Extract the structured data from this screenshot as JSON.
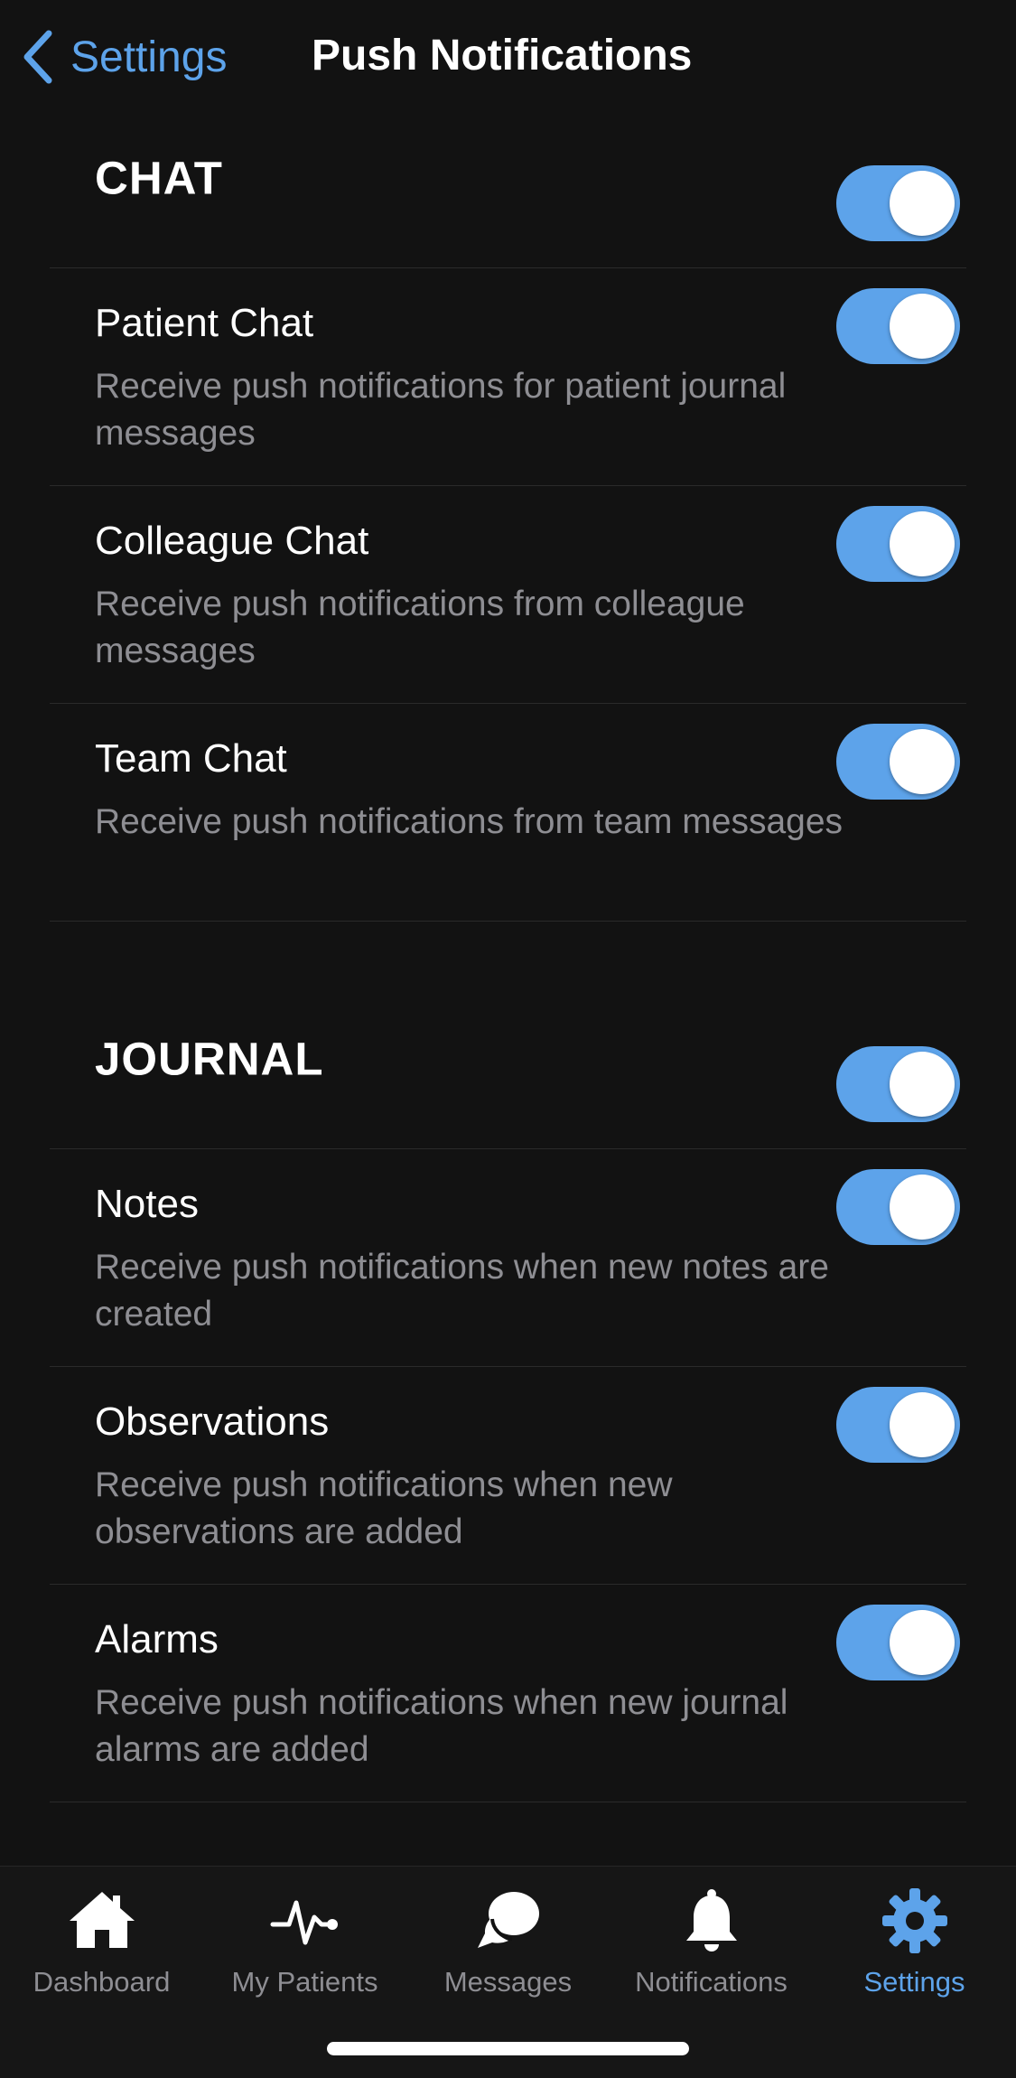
{
  "header": {
    "back_label": "Settings",
    "title": "Push Notifications"
  },
  "sections": [
    {
      "title": "CHAT",
      "enabled": true,
      "items": [
        {
          "title": "Patient Chat",
          "description": "Receive push notifications for patient journal messages",
          "enabled": true
        },
        {
          "title": "Colleague Chat",
          "description": "Receive push notifications from colleague messages",
          "enabled": true
        },
        {
          "title": "Team Chat",
          "description": "Receive push notifications from team messages",
          "enabled": true
        }
      ]
    },
    {
      "title": "JOURNAL",
      "enabled": true,
      "items": [
        {
          "title": "Notes",
          "description": "Receive push notifications when new notes are created",
          "enabled": true
        },
        {
          "title": "Observations",
          "description": "Receive push notifications when new observations are added",
          "enabled": true
        },
        {
          "title": "Alarms",
          "description": "Receive push notifications when new journal alarms are added",
          "enabled": true
        }
      ]
    }
  ],
  "tab_bar": {
    "tabs": [
      {
        "label": "Dashboard",
        "icon": "home-icon",
        "active": false
      },
      {
        "label": "My Patients",
        "icon": "heartbeat-icon",
        "active": false
      },
      {
        "label": "Messages",
        "icon": "chat-bubbles-icon",
        "active": false
      },
      {
        "label": "Notifications",
        "icon": "bell-icon",
        "active": false
      },
      {
        "label": "Settings",
        "icon": "gear-icon",
        "active": true
      }
    ]
  },
  "colors": {
    "accent": "#5da3ea",
    "background": "#121212",
    "secondary_text": "#8e8e93",
    "separator": "#2a2a2a"
  }
}
